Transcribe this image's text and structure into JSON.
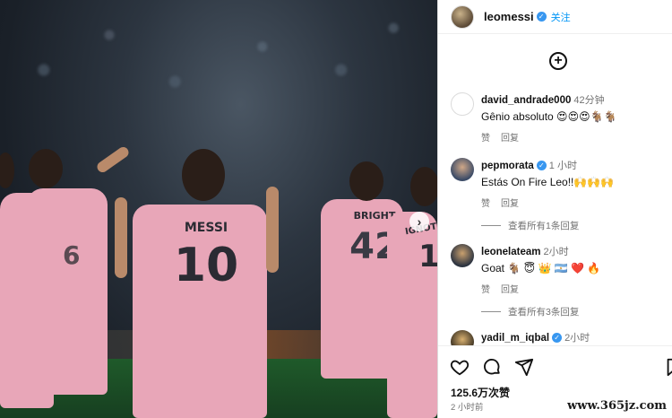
{
  "post": {
    "username": "leomessi",
    "follow_label": "关注",
    "jersey_names": [
      "MESSI",
      "BRIGHT",
      "IGNOTE"
    ],
    "jersey_numbers": [
      "10",
      "42",
      "6",
      "1"
    ]
  },
  "comments": [
    {
      "username": "david_andrade000",
      "time": "42分钟",
      "text": "Gênio absoluto 😍😍😍🐐🐐",
      "like_label": "赞",
      "reply_label": "回复"
    },
    {
      "username": "pepmorata",
      "time": "1 小时",
      "text": "Estás On Fire Leo!!🙌🙌🙌",
      "like_label": "赞",
      "reply_label": "回复",
      "view_replies": "查看所有1条回复"
    },
    {
      "username": "leonelateam",
      "time": "2小时",
      "text": "Goat 🐐 😇 👑 🇦🇷 ❤️ 🔥",
      "like_label": "赞",
      "reply_label": "回复",
      "view_replies": "查看所有3条回复"
    },
    {
      "username": "yadil_m_iqbal",
      "time": "2小时"
    }
  ],
  "footer": {
    "likes": "125.6万次赞",
    "posted": "2 小时前",
    "watermark": "www.365jz.com"
  },
  "icons": [
    "plus-circle-icon",
    "heart-icon",
    "comment-icon",
    "share-icon",
    "bookmark-icon",
    "verified-icon",
    "chevron-right-icon"
  ]
}
